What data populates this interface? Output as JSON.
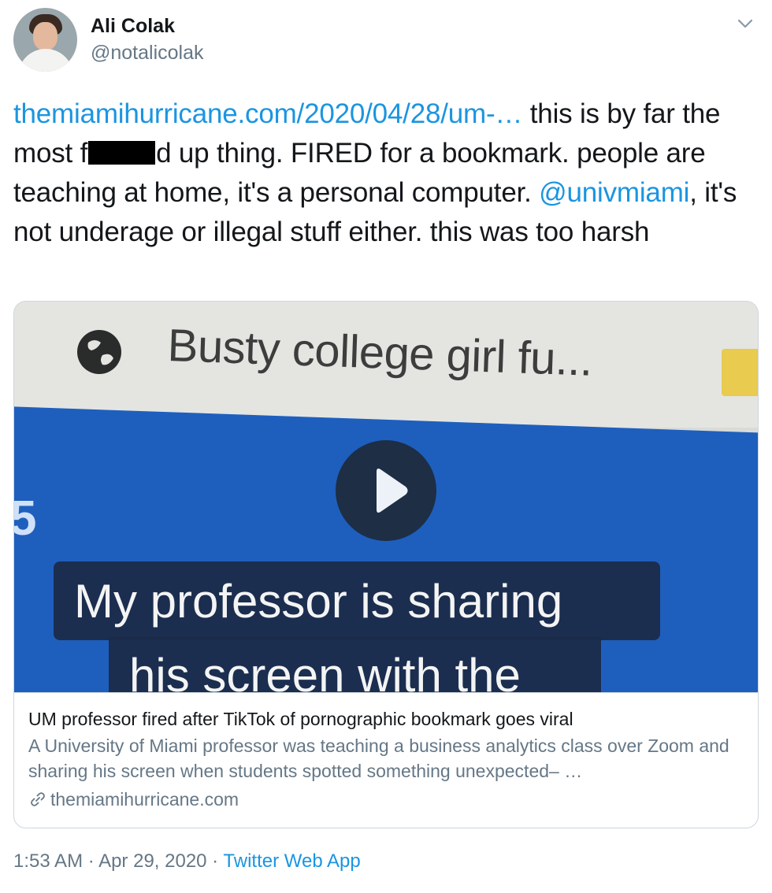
{
  "author": {
    "display_name": "Ali Colak",
    "handle": "@notalicolak"
  },
  "icons": {
    "avatar": "avatar-photo",
    "menu": "chevron-down-icon",
    "play": "play-icon",
    "link": "link-icon"
  },
  "tweet": {
    "link_text": "themiamihurricane.com/2020/04/28/um-…",
    "text_part1": " this is by far the most f",
    "text_part2": "d up thing. FIRED for a bookmark. people are teaching at home, it's a personal computer. ",
    "mention": "@univmiami",
    "text_part3": ", it's not underage or illegal stuff either. this was too harsh"
  },
  "card": {
    "thumbnail_text": {
      "top_line": "Busty college girl fu...",
      "left_number": "5",
      "caption_line1": "My professor is sharing",
      "caption_line2": "his screen with the"
    },
    "title": "UM professor fired after TikTok of pornographic bookmark goes viral",
    "description": "A University of Miami professor was teaching a business analytics class over Zoom and sharing his screen when students spotted something unexpected– …",
    "domain": "themiamihurricane.com"
  },
  "footer": {
    "time": "1:53 AM",
    "separator": " · ",
    "date": "Apr 29, 2020",
    "source": "Twitter Web App"
  },
  "colors": {
    "link": "#1b95e0",
    "secondary_text": "#657786",
    "border": "#ccd6dd"
  }
}
